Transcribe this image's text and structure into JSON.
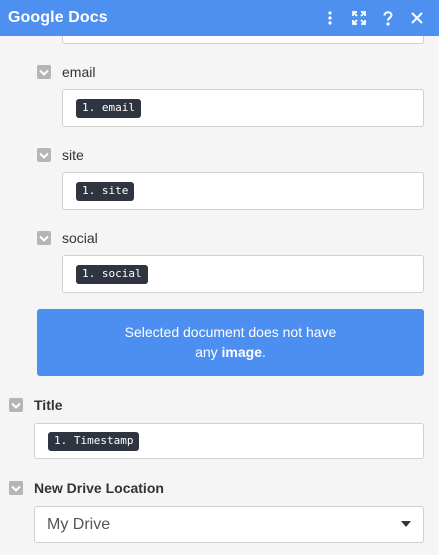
{
  "header": {
    "title": "Google Docs",
    "icons": [
      "more-vertical-icon",
      "expand-icon",
      "help-icon",
      "close-icon"
    ]
  },
  "fields": [
    {
      "label": "email",
      "value": "1. email"
    },
    {
      "label": "site",
      "value": "1. site"
    },
    {
      "label": "social",
      "value": "1. social"
    }
  ],
  "notice": {
    "line1": "Selected document does not have",
    "line2_prefix": "any ",
    "line2_bold": "image",
    "line2_suffix": "."
  },
  "title_section": {
    "label": "Title",
    "value": "1. Timestamp"
  },
  "drive_section": {
    "label": "New Drive Location",
    "selected": "My Drive"
  },
  "colors": {
    "accent": "#4d90f0",
    "pill": "#2e3540",
    "checkbox": "#b5b5b5"
  }
}
